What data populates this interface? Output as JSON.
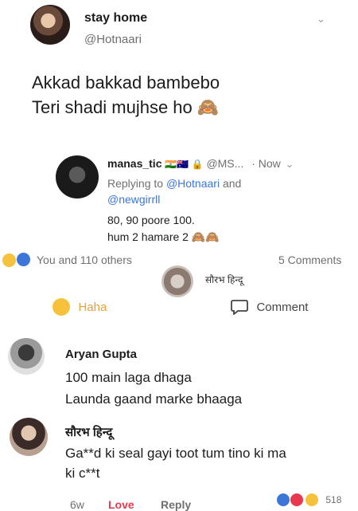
{
  "tweet": {
    "author_name": "stay home",
    "author_handle": "@Hotnaari",
    "line1": "Akkad bakkad bambebo",
    "line2": "Teri shadi mujhse ho 🙈"
  },
  "reply": {
    "author_name": "manas_tic",
    "flags": "🇮🇳🇦🇺 🔒",
    "handle": "@MS...",
    "time": "· Now",
    "replying_prefix": "Replying to ",
    "replying_to": "@Hotnaari",
    "replying_and": " and",
    "replying_to2": "@newgirrll",
    "line1": "80, 90 poore 100.",
    "line2": "hum 2 hamare 2 🙈🙈"
  },
  "post_stats": {
    "reactions_text": "You and 110 others",
    "comments_text": "5 Comments",
    "overlay_name": "सौरभ हिन्दू"
  },
  "actions": {
    "haha_label": "Haha",
    "comment_label": "Comment"
  },
  "comments": [
    {
      "author": "Aryan Gupta",
      "line1": "100 main laga dhaga",
      "line2": "Launda gaand marke bhaaga"
    },
    {
      "author": "सौरभ हिन्दू",
      "line1": "Ga**d ki seal gayi toot tum tino ki ma",
      "line2": "ki c**t"
    }
  ],
  "footer": {
    "time": "6w",
    "love_label": "Love",
    "reply_label": "Reply",
    "reaction_count": "518"
  },
  "colors": {
    "link_blue": "#3b76d8",
    "love_red": "#e8384f",
    "haha_yellow": "#f7c23b"
  }
}
